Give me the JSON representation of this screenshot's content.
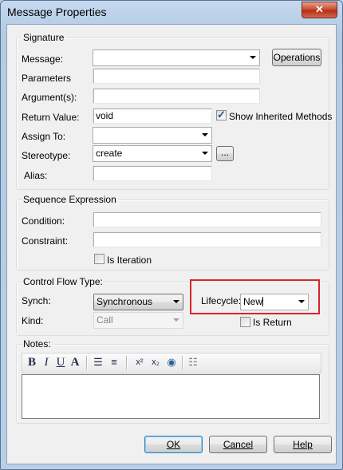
{
  "window": {
    "title": "Message Properties",
    "close_label": "✕"
  },
  "signature": {
    "group_label": "Signature",
    "message_label": "Message:",
    "message_value": "",
    "operations_button": "Operations",
    "parameters_label": "Parameters",
    "parameters_value": "",
    "arguments_label": "Argument(s):",
    "arguments_value": "",
    "return_value_label": "Return Value:",
    "return_value_value": "void",
    "show_inherited_label": "Show Inherited Methods",
    "show_inherited_checked": true,
    "assign_to_label": "Assign To:",
    "assign_to_value": "",
    "stereotype_label": "Stereotype:",
    "stereotype_value": "create",
    "stereotype_browse": "...",
    "alias_label": "Alias:",
    "alias_value": ""
  },
  "sequence": {
    "group_label": "Sequence Expression",
    "condition_label": "Condition:",
    "condition_value": "",
    "constraint_label": "Constraint:",
    "constraint_value": "",
    "is_iteration_label": "Is Iteration",
    "is_iteration_checked": false
  },
  "control_flow": {
    "group_label": "Control Flow Type:",
    "synch_label": "Synch:",
    "synch_value": "Synchronous",
    "kind_label": "Kind:",
    "kind_value": "Call",
    "lifecycle_label": "Lifecycle:",
    "lifecycle_value": "New",
    "is_return_label": "Is Return",
    "is_return_checked": false
  },
  "notes": {
    "group_label": "Notes:",
    "toolbar": [
      {
        "name": "bold-icon",
        "glyph": "B"
      },
      {
        "name": "italic-icon",
        "glyph": "I"
      },
      {
        "name": "underline-icon",
        "glyph": "U"
      },
      {
        "name": "font-color-icon",
        "glyph": "A"
      },
      {
        "name": "bullet-list-icon",
        "glyph": "☰"
      },
      {
        "name": "numbered-list-icon",
        "glyph": "≡"
      },
      {
        "name": "superscript-icon",
        "glyph": "x²"
      },
      {
        "name": "subscript-icon",
        "glyph": "x₂"
      },
      {
        "name": "hyperlink-icon",
        "glyph": "◉"
      },
      {
        "name": "document-icon",
        "glyph": "☷"
      }
    ],
    "value": ""
  },
  "buttons": {
    "ok": "OK",
    "cancel": "Cancel",
    "help": "Help"
  },
  "colors": {
    "highlight": "#d9242b",
    "window_frame": "#bcd2ea"
  }
}
